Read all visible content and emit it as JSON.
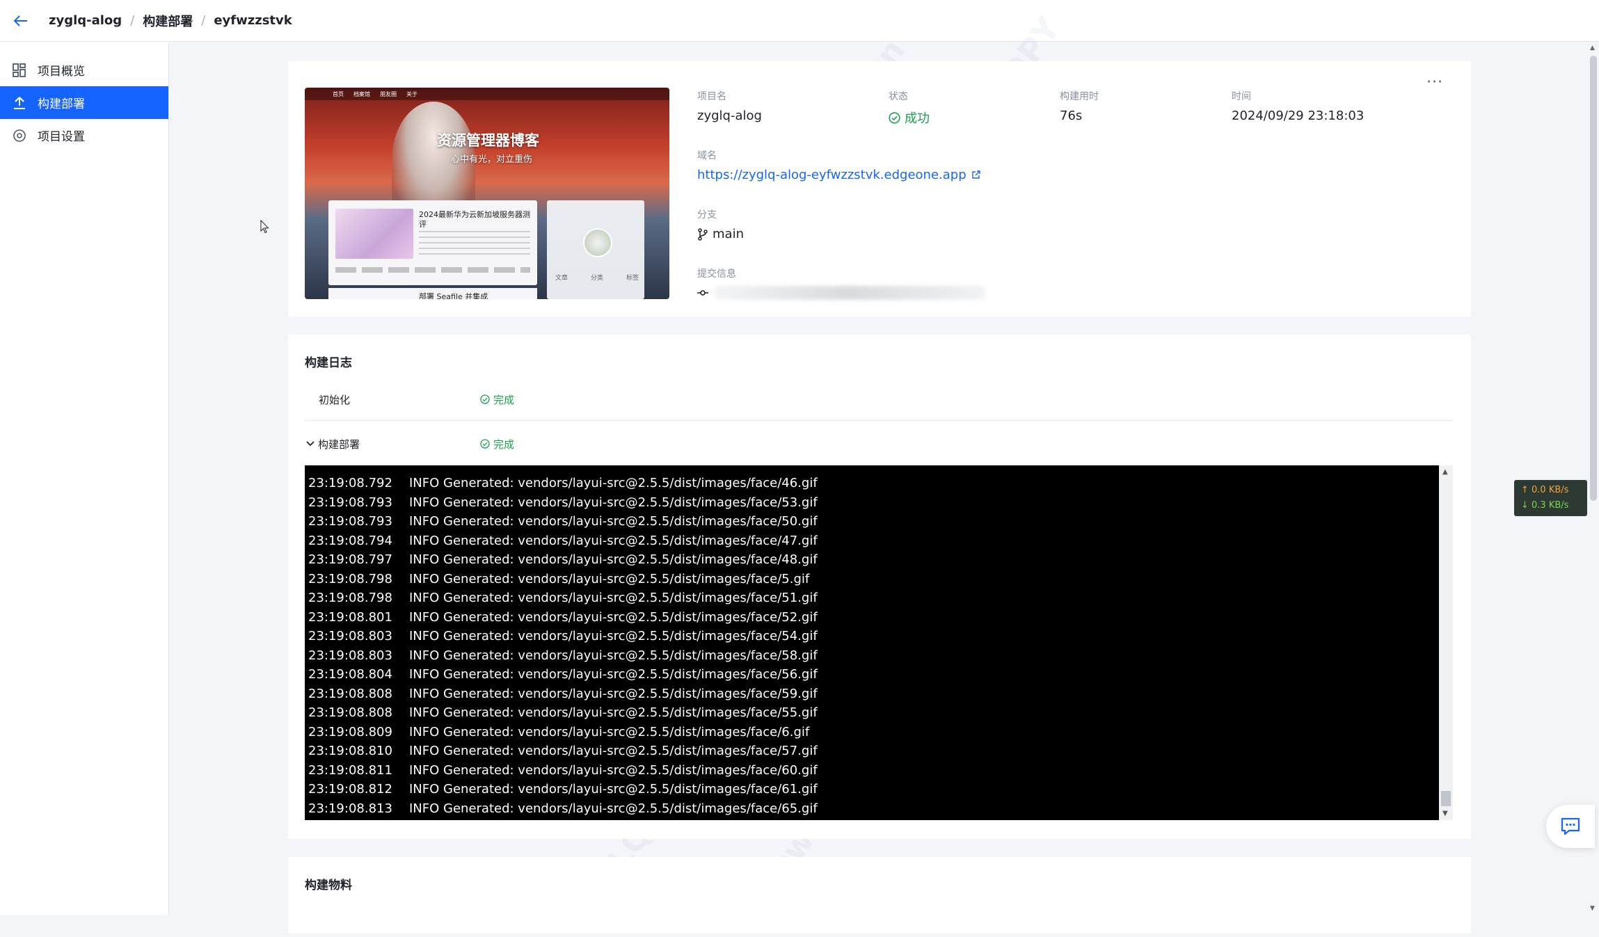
{
  "breadcrumb": {
    "items": [
      "zyglq-alog",
      "构建部署",
      "eyfwzzstvk"
    ],
    "separator": "/"
  },
  "sidebar": {
    "items": [
      {
        "label": "项目概览",
        "icon": "dashboard-icon",
        "active": false
      },
      {
        "label": "构建部署",
        "icon": "deploy-icon",
        "active": true
      },
      {
        "label": "项目设置",
        "icon": "settings-icon",
        "active": false
      }
    ]
  },
  "overview": {
    "project_name_label": "项目名",
    "project_name": "zyglq-alog",
    "status_label": "状态",
    "status": "成功",
    "build_time_label": "构建用时",
    "build_time": "76s",
    "time_label": "时间",
    "time": "2024/09/29 23:18:03",
    "domain_label": "域名",
    "domain": "https://zyglq-alog-eyfwzzstvk.edgeone.app",
    "branch_label": "分支",
    "branch": "main",
    "commit_label": "提交信息",
    "more": "···"
  },
  "preview": {
    "nav": [
      "首页",
      "档案馆",
      "朋友圈",
      "关于"
    ],
    "title": "资源管理器博客",
    "subtitle": "心中有光，对立重伤",
    "post_title": "2024最新华为云新加坡服务器测评",
    "post2_title": "部署 Seafile 并集成",
    "stats": [
      "文章",
      "分类",
      "标签"
    ]
  },
  "build_log": {
    "title": "构建日志",
    "steps": [
      {
        "name": "初始化",
        "status": "完成",
        "expanded": false
      },
      {
        "name": "构建部署",
        "status": "完成",
        "expanded": true
      }
    ],
    "lines": [
      {
        "time": "23:19:08.792",
        "msg": "INFO Generated: vendors/layui-src@2.5.5/dist/images/face/46.gif"
      },
      {
        "time": "23:19:08.793",
        "msg": "INFO Generated: vendors/layui-src@2.5.5/dist/images/face/53.gif"
      },
      {
        "time": "23:19:08.793",
        "msg": "INFO Generated: vendors/layui-src@2.5.5/dist/images/face/50.gif"
      },
      {
        "time": "23:19:08.794",
        "msg": "INFO Generated: vendors/layui-src@2.5.5/dist/images/face/47.gif"
      },
      {
        "time": "23:19:08.797",
        "msg": "INFO Generated: vendors/layui-src@2.5.5/dist/images/face/48.gif"
      },
      {
        "time": "23:19:08.798",
        "msg": "INFO Generated: vendors/layui-src@2.5.5/dist/images/face/5.gif"
      },
      {
        "time": "23:19:08.798",
        "msg": "INFO Generated: vendors/layui-src@2.5.5/dist/images/face/51.gif"
      },
      {
        "time": "23:19:08.801",
        "msg": "INFO Generated: vendors/layui-src@2.5.5/dist/images/face/52.gif"
      },
      {
        "time": "23:19:08.803",
        "msg": "INFO Generated: vendors/layui-src@2.5.5/dist/images/face/54.gif"
      },
      {
        "time": "23:19:08.803",
        "msg": "INFO Generated: vendors/layui-src@2.5.5/dist/images/face/58.gif"
      },
      {
        "time": "23:19:08.804",
        "msg": "INFO Generated: vendors/layui-src@2.5.5/dist/images/face/56.gif"
      },
      {
        "time": "23:19:08.808",
        "msg": "INFO Generated: vendors/layui-src@2.5.5/dist/images/face/59.gif"
      },
      {
        "time": "23:19:08.808",
        "msg": "INFO Generated: vendors/layui-src@2.5.5/dist/images/face/55.gif"
      },
      {
        "time": "23:19:08.809",
        "msg": "INFO Generated: vendors/layui-src@2.5.5/dist/images/face/6.gif"
      },
      {
        "time": "23:19:08.810",
        "msg": "INFO Generated: vendors/layui-src@2.5.5/dist/images/face/57.gif"
      },
      {
        "time": "23:19:08.811",
        "msg": "INFO Generated: vendors/layui-src@2.5.5/dist/images/face/60.gif"
      },
      {
        "time": "23:19:08.812",
        "msg": "INFO Generated: vendors/layui-src@2.5.5/dist/images/face/61.gif"
      },
      {
        "time": "23:19:08.813",
        "msg": "INFO Generated: vendors/layui-src@2.5.5/dist/images/face/65.gif"
      }
    ]
  },
  "artifacts": {
    "title": "构建物料"
  },
  "netspeed": {
    "up": "↑ 0.0 KB/s",
    "down": "↓ 0.3 KB/s"
  },
  "watermark": {
    "texts": [
      "ZYGLQ Blog",
      "www.zvala.cn",
      "DO NOT COPY"
    ]
  },
  "colors": {
    "accent": "#1664ff",
    "success": "#1aa34a",
    "terminal_bg": "#000000"
  }
}
